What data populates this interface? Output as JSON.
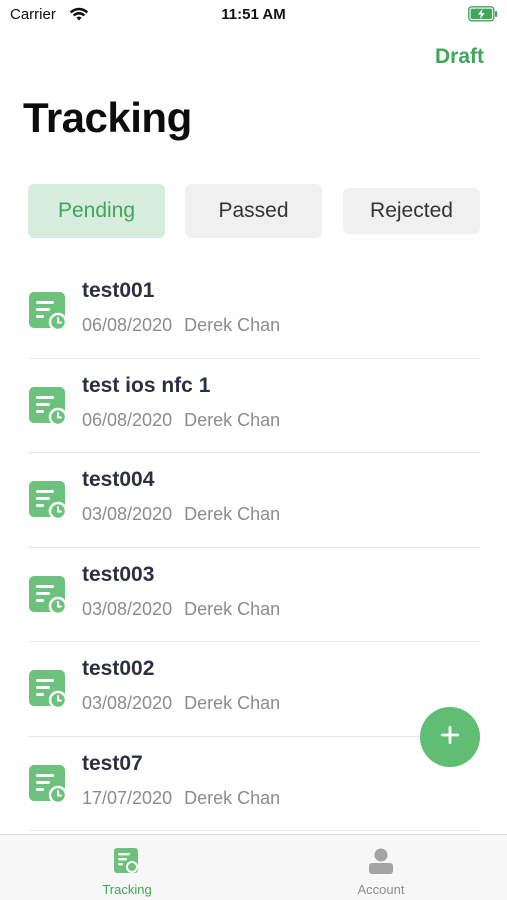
{
  "status_bar": {
    "carrier": "Carrier",
    "time": "11:51 AM",
    "battery_color": "#3fa65a"
  },
  "header": {
    "draft_label": "Draft",
    "title": "Tracking"
  },
  "tabs": [
    {
      "label": "Pending",
      "active": true
    },
    {
      "label": "Passed",
      "active": false
    },
    {
      "label": "Rejected",
      "active": false
    }
  ],
  "items": [
    {
      "title": "test001",
      "date": "06/08/2020",
      "author": "Derek Chan",
      "icon": "document-clock-icon"
    },
    {
      "title": "test ios nfc 1",
      "date": "06/08/2020",
      "author": "Derek Chan",
      "icon": "document-clock-icon"
    },
    {
      "title": "test004",
      "date": "03/08/2020",
      "author": "Derek Chan",
      "icon": "document-clock-icon"
    },
    {
      "title": "test003",
      "date": "03/08/2020",
      "author": "Derek Chan",
      "icon": "document-clock-icon"
    },
    {
      "title": "test002",
      "date": "03/08/2020",
      "author": "Derek Chan",
      "icon": "document-clock-icon"
    },
    {
      "title": "test07",
      "date": "17/07/2020",
      "author": "Derek Chan",
      "icon": "document-clock-icon"
    }
  ],
  "fab": {
    "icon": "plus-icon"
  },
  "tabbar": {
    "tracking_label": "Tracking",
    "account_label": "Account"
  },
  "colors": {
    "accent": "#3fa65a",
    "fab": "#5fbe73",
    "icon_green": "#6cc27c"
  }
}
